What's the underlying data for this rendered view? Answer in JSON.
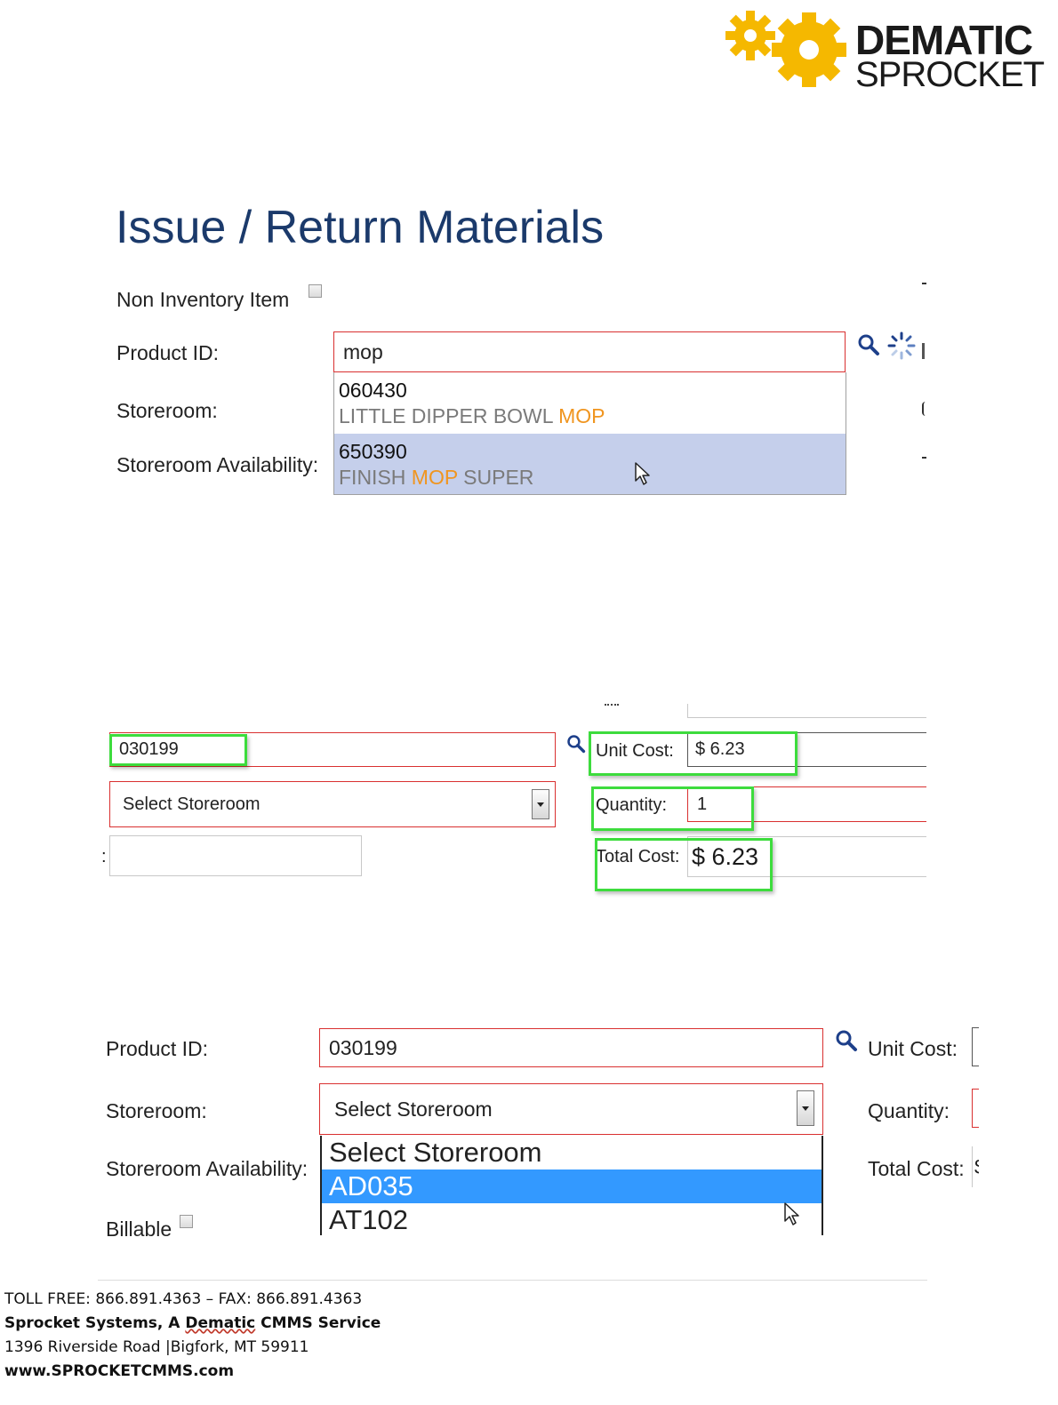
{
  "logo": {
    "line1": "DEMATIC",
    "line2": "SPROCKET",
    "gear_color": "#f5b800"
  },
  "page_title": "Issue / Return Materials",
  "panel1": {
    "non_inventory_label": "Non Inventory Item",
    "product_id_label": "Product ID:",
    "product_id_value": "mop",
    "storeroom_label": "Storeroom:",
    "availability_label": "Storeroom Availability:",
    "autocomplete": [
      {
        "code": "060430",
        "desc_pre": "LITTLE DIPPER BOWL ",
        "desc_hl": "MOP",
        "desc_post": ""
      },
      {
        "code": "650390",
        "desc_pre": "FINISH ",
        "desc_hl": "MOP",
        "desc_post": " SUPER"
      }
    ],
    "highlight_color": "#f0951f",
    "selected_bg": "#c5cfeb"
  },
  "panel2": {
    "product_id_value": "030199",
    "storeroom_placeholder": "Select Storeroom",
    "colon": ":",
    "unit_cost_label": "Unit Cost:",
    "unit_cost_value": "$ 6.23",
    "quantity_label": "Quantity:",
    "quantity_value": "1",
    "total_cost_label": "Total Cost:",
    "total_cost_value": "$ 6.23",
    "annotation_color": "#3ddc3d"
  },
  "panel3": {
    "product_id_label": "Product ID:",
    "product_id_value": "030199",
    "storeroom_label": "Storeroom:",
    "storeroom_value": "Select Storeroom",
    "availability_label": "Storeroom Availability:",
    "billable_label": "Billable",
    "unit_cost_label": "Unit Cost:",
    "quantity_label": "Quantity:",
    "total_cost_label": "Total Cost:",
    "total_cost_partial": "$",
    "dropdown_options": [
      "Select Storeroom",
      "AD035",
      "AT102"
    ],
    "selected_color": "#3399ff"
  },
  "footer": {
    "phones": "TOLL FREE: 866.891.4363 – FAX: 866.891.4363",
    "company_a": "Sprocket Systems, A ",
    "company_b": "Dematic",
    "company_c": " CMMS Service",
    "address": "1396 Riverside  Road |Bigfork, MT 59911",
    "website": "www.SPROCKETCMMS.com"
  }
}
